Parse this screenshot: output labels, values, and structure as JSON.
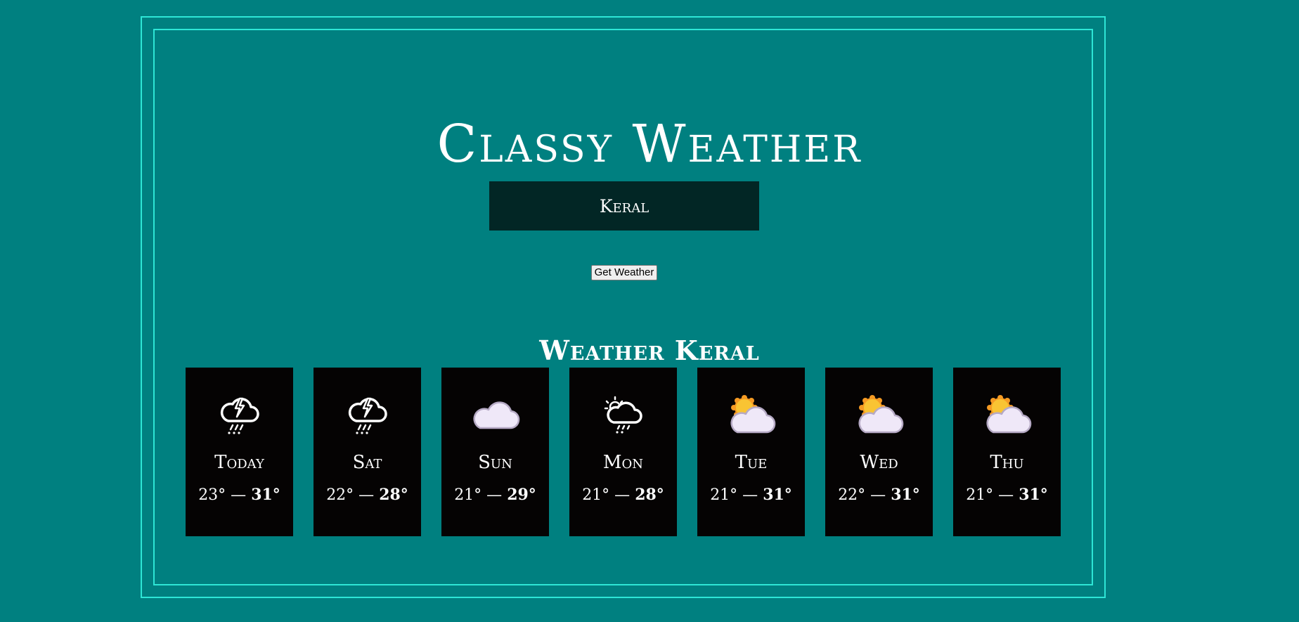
{
  "app": {
    "title": "Classy Weather"
  },
  "search": {
    "value": "Keral",
    "button_label": "Get Weather"
  },
  "forecast": {
    "heading": "Weather Keral",
    "days": [
      {
        "name": "Today",
        "min": "23°",
        "sep": " — ",
        "max": "31°",
        "icon": "thunderstorm-rain-icon"
      },
      {
        "name": "Sat",
        "min": "22°",
        "sep": " — ",
        "max": "28°",
        "icon": "thunderstorm-rain-icon"
      },
      {
        "name": "Sun",
        "min": "21°",
        "sep": " — ",
        "max": "29°",
        "icon": "cloud-icon"
      },
      {
        "name": "Mon",
        "min": "21°",
        "sep": " — ",
        "max": "28°",
        "icon": "sun-cloud-drizzle-icon"
      },
      {
        "name": "Tue",
        "min": "21°",
        "sep": " — ",
        "max": "31°",
        "icon": "partly-cloudy-icon"
      },
      {
        "name": "Wed",
        "min": "22°",
        "sep": " — ",
        "max": "31°",
        "icon": "partly-cloudy-icon"
      },
      {
        "name": "Thu",
        "min": "21°",
        "sep": " — ",
        "max": "31°",
        "icon": "partly-cloudy-icon"
      }
    ]
  },
  "colors": {
    "background": "#008080",
    "frame": "#2ee6d6",
    "input_bg": "#022625",
    "card_bg": "#050303"
  }
}
